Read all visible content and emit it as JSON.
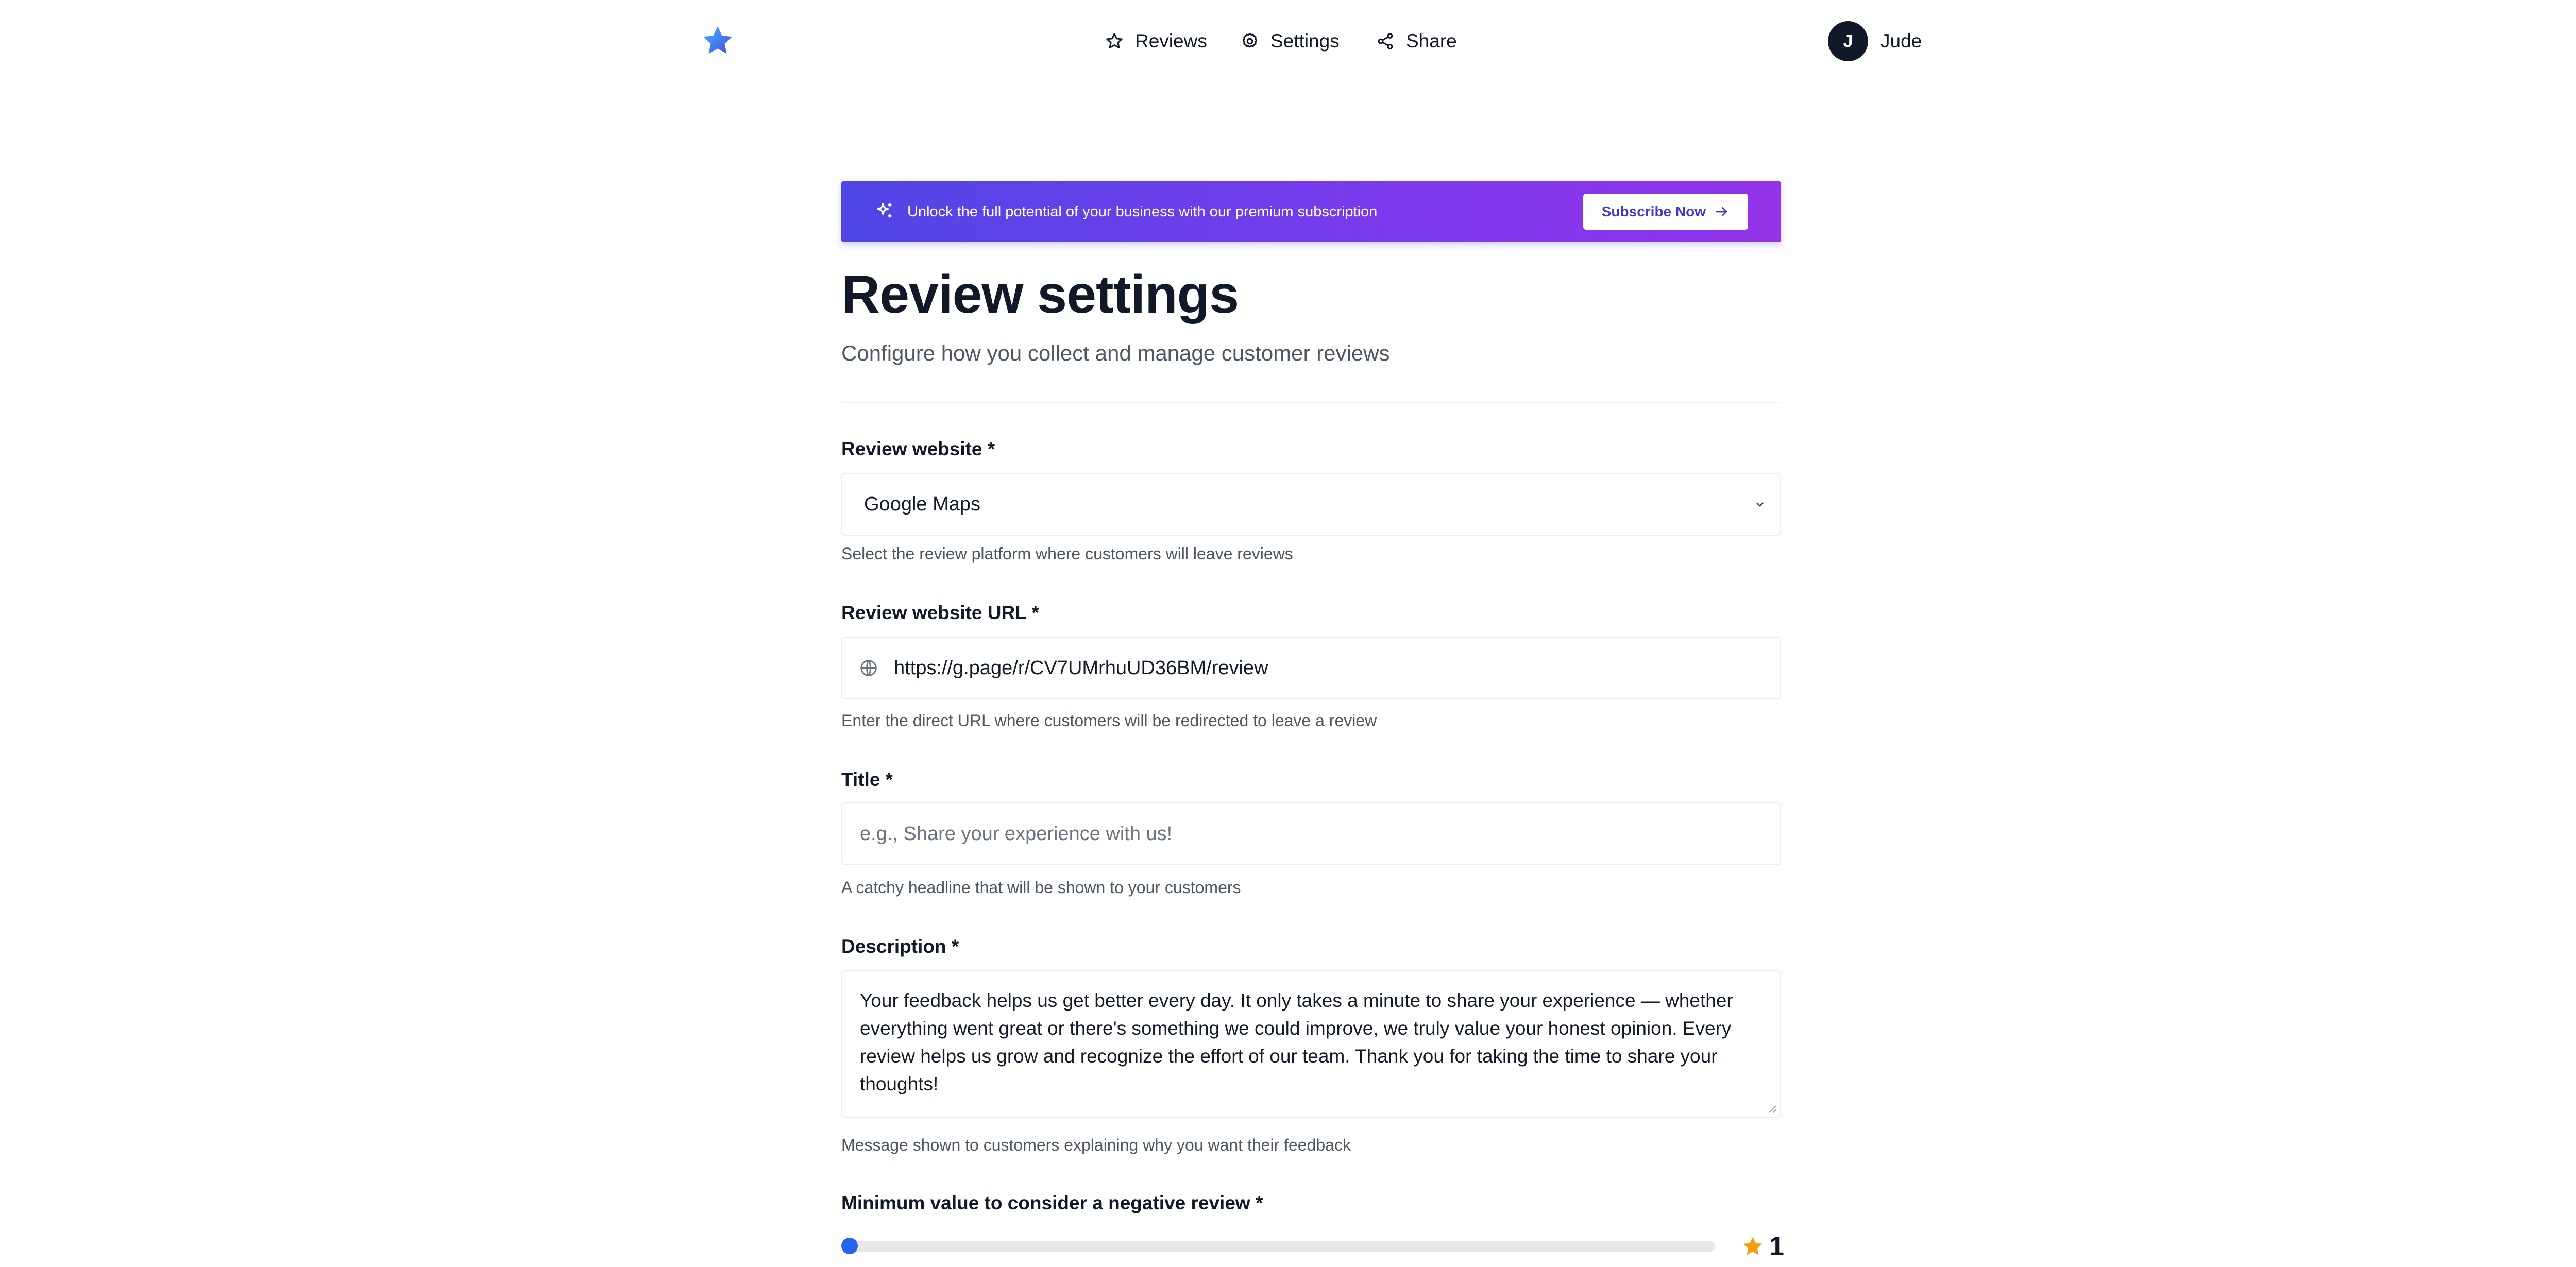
{
  "nav": {
    "items": [
      {
        "label": "Reviews",
        "icon": "star-icon"
      },
      {
        "label": "Settings",
        "icon": "gear-icon"
      },
      {
        "label": "Share",
        "icon": "share-icon"
      }
    ],
    "user": {
      "initial": "J",
      "name": "Jude"
    }
  },
  "banner": {
    "text": "Unlock the full potential of your business with our premium subscription",
    "button_label": "Subscribe Now",
    "icon": "sparkles-icon"
  },
  "page": {
    "title": "Review settings",
    "subtitle": "Configure how you collect and manage customer reviews"
  },
  "form": {
    "review_website": {
      "label": "Review website *",
      "value": "Google Maps",
      "help": "Select the review platform where customers will leave reviews"
    },
    "review_url": {
      "label": "Review website URL *",
      "value": "https://g.page/r/CV7UMrhuUD36BM/review",
      "help": "Enter the direct URL where customers will be redirected to leave a review"
    },
    "title": {
      "label": "Title *",
      "value": "",
      "placeholder": "e.g., Share your experience with us!",
      "help": "A catchy headline that will be shown to your customers"
    },
    "description": {
      "label": "Description *",
      "value": "Your feedback helps us get better every day. It only takes a minute to share your experience — whether everything went great or there's something we could improve, we truly value your honest opinion. Every review helps us grow and recognize the effort of our team. Thank you for taking the time to share your thoughts!",
      "help": "Message shown to customers explaining why you want their feedback"
    },
    "negative_threshold": {
      "label": "Minimum value to consider a negative review *",
      "value": "1",
      "level_fraction": 0
    }
  },
  "colors": {
    "brand_blue": "#2563eb",
    "banner_start": "#4f46e5",
    "banner_end": "#9333ea",
    "star_orange": "#f59e0b"
  }
}
